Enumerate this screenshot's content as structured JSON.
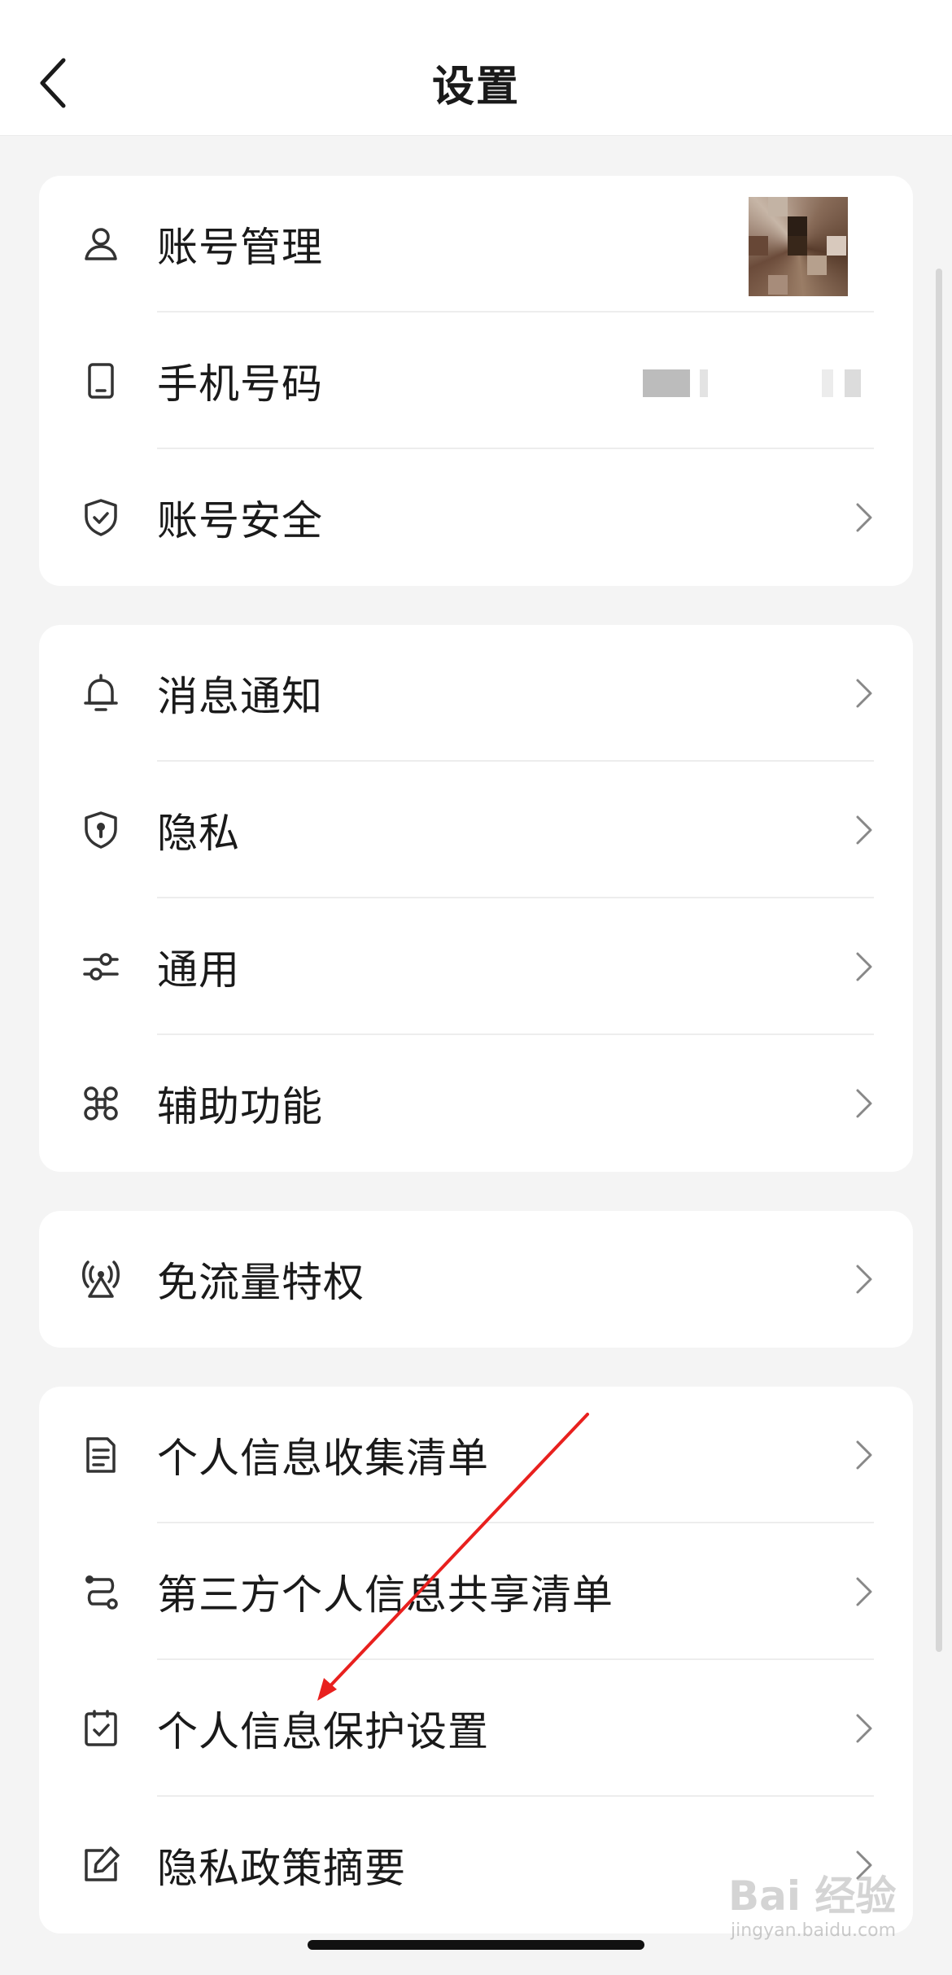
{
  "header": {
    "title": "设置"
  },
  "groups": [
    {
      "items": [
        {
          "label": "账号管理"
        },
        {
          "label": "手机号码"
        },
        {
          "label": "账号安全"
        }
      ]
    },
    {
      "items": [
        {
          "label": "消息通知"
        },
        {
          "label": "隐私"
        },
        {
          "label": "通用"
        },
        {
          "label": "辅助功能"
        }
      ]
    },
    {
      "items": [
        {
          "label": "免流量特权"
        }
      ]
    },
    {
      "items": [
        {
          "label": "个人信息收集清单"
        },
        {
          "label": "第三方个人信息共享清单"
        },
        {
          "label": "个人信息保护设置"
        },
        {
          "label": "隐私政策摘要"
        }
      ]
    }
  ],
  "watermark": {
    "brand": "Bai 经验",
    "url": "jingyan.baidu.com"
  },
  "colors": {
    "annotation_arrow": "#e8201e",
    "background": "#f4f4f4",
    "card": "#ffffff"
  }
}
